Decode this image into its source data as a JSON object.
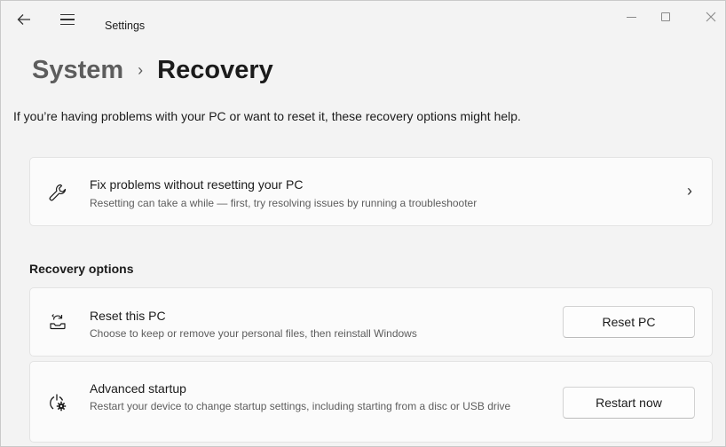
{
  "window": {
    "title": "Settings",
    "back_icon": "back-arrow-icon",
    "menu_icon": "hamburger-menu-icon"
  },
  "breadcrumb": {
    "parent": "System",
    "separator": "›",
    "current": "Recovery"
  },
  "intro": "If you’re having problems with your PC or want to reset it, these recovery options might help.",
  "fix_card": {
    "icon": "wrench-icon",
    "title": "Fix problems without resetting your PC",
    "description": "Resetting can take a while — first, try resolving issues by running a troubleshooter",
    "chevron": "›"
  },
  "recovery_options": {
    "heading": "Recovery options",
    "items": [
      {
        "icon": "reset-pc-icon",
        "title": "Reset this PC",
        "description": "Choose to keep or remove your personal files, then reinstall Windows",
        "button": "Reset PC"
      },
      {
        "icon": "advanced-startup-icon",
        "title": "Advanced startup",
        "description": "Restart your device to change startup settings, including starting from a disc or USB drive",
        "button": "Restart now"
      }
    ]
  },
  "colors": {
    "background": "#f3f3f3",
    "card": "#fbfbfb",
    "text": "#1b1b1b",
    "secondary_text": "#5d5d5d"
  }
}
